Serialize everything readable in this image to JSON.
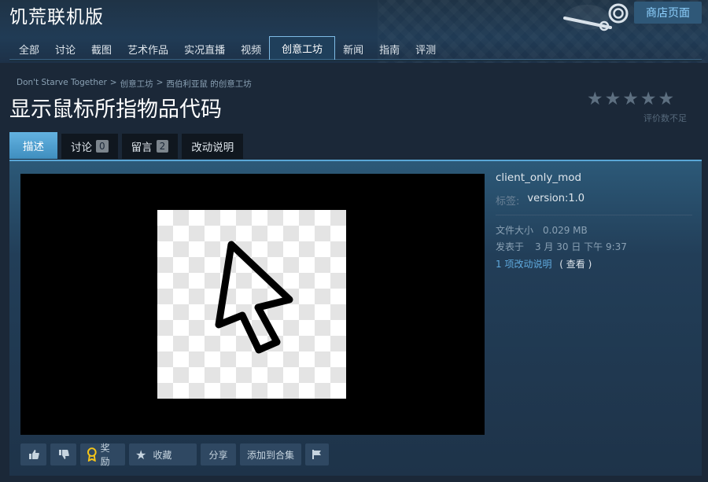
{
  "header": {
    "app_title": "饥荒联机版",
    "store_button": "商店页面",
    "nav_tabs": [
      {
        "label": "全部"
      },
      {
        "label": "讨论"
      },
      {
        "label": "截图"
      },
      {
        "label": "艺术作品"
      },
      {
        "label": "实况直播"
      },
      {
        "label": "视频"
      },
      {
        "label": "创意工坊",
        "active": true
      },
      {
        "label": "新闻"
      },
      {
        "label": "指南"
      },
      {
        "label": "评测"
      }
    ]
  },
  "breadcrumb": {
    "items": [
      "Don't Starve Together",
      "创意工坊",
      "西伯利亚鼠 的创意工坊"
    ],
    "separator": ">"
  },
  "page_title": "显示鼠标所指物品代码",
  "rating": {
    "stars": 5,
    "filled": 0,
    "note": "评价数不足"
  },
  "tabs": [
    {
      "label": "描述",
      "active": true
    },
    {
      "label": "讨论",
      "count": "0"
    },
    {
      "label": "留言",
      "count": "2"
    },
    {
      "label": "改动说明"
    }
  ],
  "details": {
    "tag_main": "client_only_mod",
    "tag_label": "标签:",
    "tag_value": "version:1.0",
    "file_size_label": "文件大小",
    "file_size_value": "0.029 MB",
    "posted_label": "发表于",
    "posted_value": "3 月 30 日 下午 9:37",
    "changelog_link": "1 项改动说明",
    "changelog_view": "( 查看 )"
  },
  "actions": {
    "award": "奖励",
    "favorite": "收藏",
    "share": "分享",
    "add_to_collection": "添加到合集"
  },
  "colors": {
    "background": "#1b2838",
    "accent": "#66c0f4",
    "active_tab": "#4f9fd0",
    "link": "#5fa9dd"
  },
  "icons": {
    "thumbs_up": "thumbs-up-icon",
    "thumbs_down": "thumbs-down-icon",
    "award": "award-icon",
    "favorite": "star-icon",
    "flag": "flag-icon",
    "preview": "cursor-arrow-icon"
  }
}
